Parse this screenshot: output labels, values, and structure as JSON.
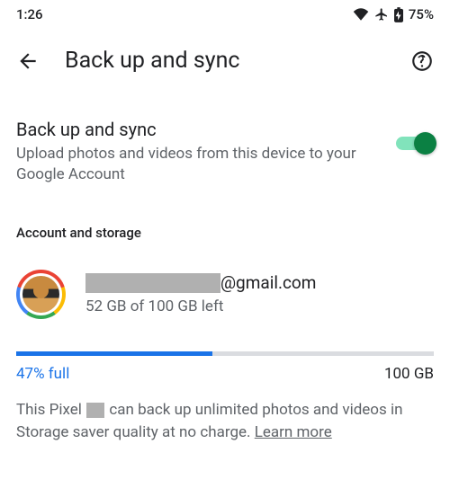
{
  "status_bar": {
    "time": "1:26",
    "battery": "75%"
  },
  "app_bar": {
    "title": "Back up and sync"
  },
  "backup": {
    "title": "Back up and sync",
    "subtitle": "Upload photos and videos from this device to your Google Account",
    "toggle_on": true
  },
  "section": {
    "header": "Account and storage"
  },
  "account": {
    "email_domain": "@gmail.com",
    "storage_line": "52 GB of 100 GB left"
  },
  "progress": {
    "pct_label": "47% full",
    "total_label": "100 GB",
    "fill_pct": 47
  },
  "footnote": {
    "prefix": "This Pixel ",
    "suffix": "can back up unlimited photos and videos in Storage saver quality at no charge. ",
    "learn_more": "Learn more"
  }
}
